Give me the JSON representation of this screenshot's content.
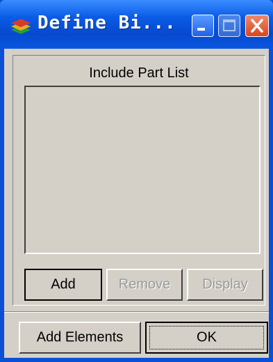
{
  "window": {
    "title": "Define Bi...",
    "app_icon": "layers-icon",
    "controls": {
      "minimize": "minimize-icon",
      "maximize": "maximize-icon",
      "close": "close-icon"
    }
  },
  "group": {
    "title": "Include Part List",
    "list_items": []
  },
  "buttons": {
    "add": "Add",
    "remove": "Remove",
    "display": "Display",
    "add_elements": "Add Elements",
    "ok": "OK"
  },
  "colors": {
    "titlebar": "#0a5ce6",
    "face": "#d4d0c8",
    "close": "#d8461f"
  }
}
